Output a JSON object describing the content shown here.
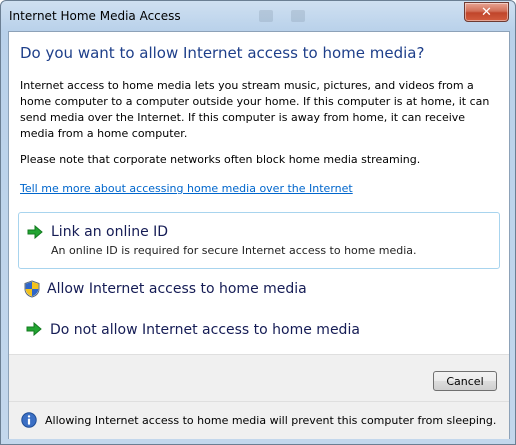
{
  "window": {
    "title": "Internet Home Media Access",
    "close_glyph": "✕"
  },
  "main": {
    "heading": "Do you want to allow Internet access to home media?",
    "paragraph1": "Internet access to home media lets you stream music, pictures, and videos from a home computer to a computer outside your home.  If this computer is at home, it can send media over the Internet.  If this computer is away from home, it can receive media from a home computer.",
    "paragraph2": "Please note that corporate networks often block home media streaming.",
    "help_link": "Tell me more about accessing home media over the Internet"
  },
  "commands": [
    {
      "title": "Link an online ID",
      "subtitle": "An online ID is required for secure Internet access to home media.",
      "icon": "green-arrow-icon"
    },
    {
      "title": "Allow Internet access to home media",
      "icon": "uac-shield-icon"
    },
    {
      "title": "Do not allow Internet access to home media",
      "icon": "green-arrow-icon"
    }
  ],
  "footer": {
    "cancel_label": "Cancel",
    "info_text": "Allowing Internet access to home media will prevent this computer from sleeping.",
    "info_icon": "info-icon"
  },
  "colors": {
    "heading": "#1e3f8a",
    "link": "#0066cc",
    "command_text": "#151c55",
    "arrow": "#1d9e2a"
  }
}
